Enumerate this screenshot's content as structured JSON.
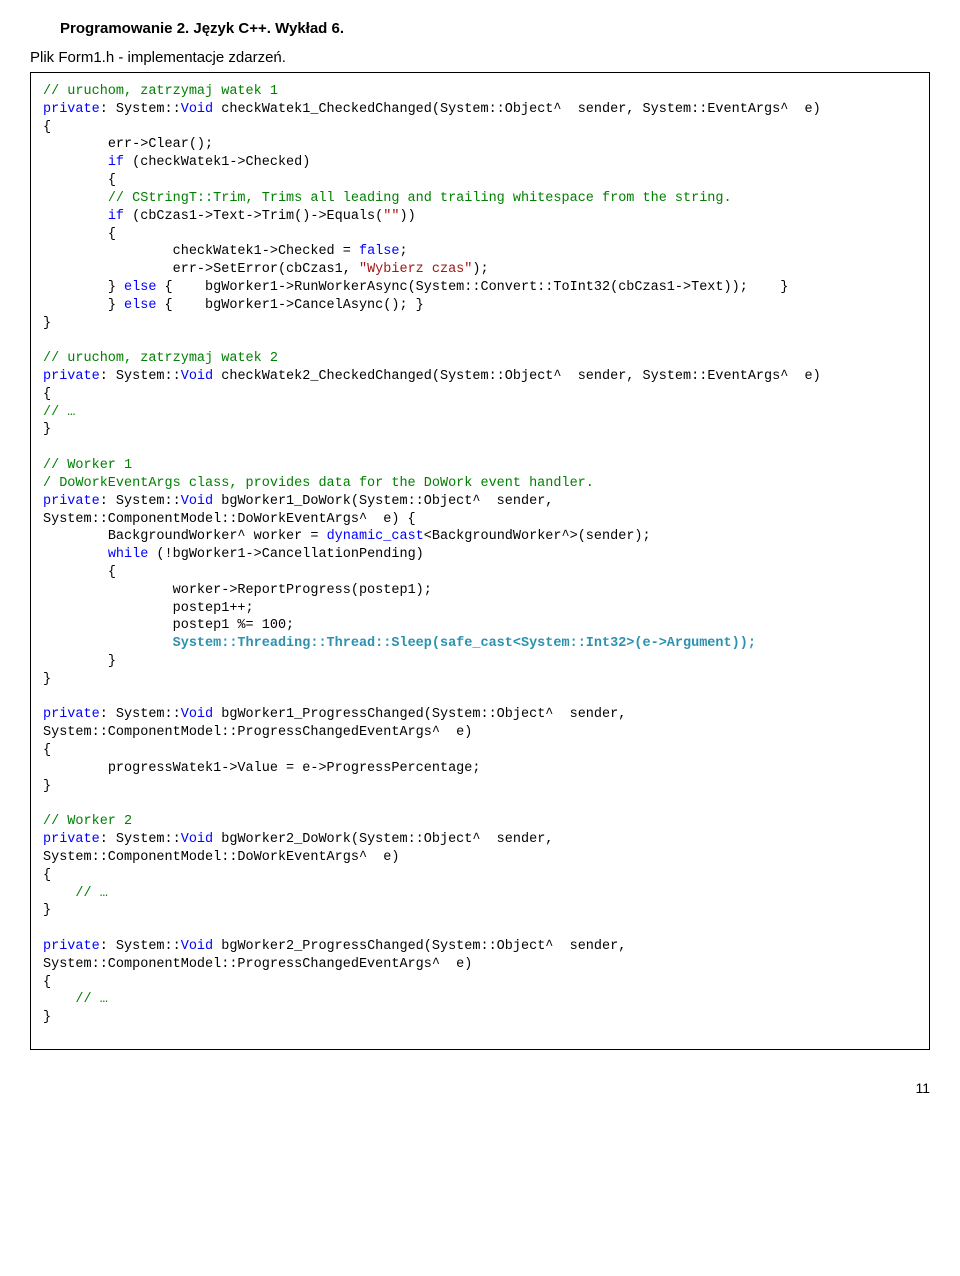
{
  "meta": {
    "title": "Programowanie 2. Język C++. Wykład 6.",
    "subtitle": "Plik Form1.h - implementacje zdarzeń.",
    "page_number": "11"
  },
  "code": {
    "l1": "// uruchom, zatrzymaj watek 1",
    "l2a": "private",
    "l2b": ": System::",
    "l2c": "Void",
    "l2d": " checkWatek1_CheckedChanged(System::Object^  sender, System::EventArgs^  e)",
    "l3": "{",
    "l4": "        err->Clear();",
    "l5a": "        ",
    "l5b": "if",
    "l5c": " (checkWatek1->Checked)",
    "l6": "        {",
    "l7": "        // CStringT::Trim, Trims all leading and trailing whitespace from the string.",
    "l8a": "        ",
    "l8b": "if",
    "l8c": " (cbCzas1->Text->Trim()->Equals(",
    "l8d": "\"\"",
    "l8e": "))",
    "l9": "        {",
    "l10a": "                checkWatek1->Checked = ",
    "l10b": "false",
    "l10c": ";",
    "l11a": "                err->SetError(cbCzas1, ",
    "l11b": "\"Wybierz czas\"",
    "l11c": ");",
    "l12a": "        } ",
    "l12b": "else",
    "l12c": " {    bgWorker1->RunWorkerAsync(System::Convert::ToInt32(cbCzas1->Text));    }",
    "l13a": "        } ",
    "l13b": "else",
    "l13c": " {    bgWorker1->CancelAsync(); }",
    "l14": "}",
    "l16": "// uruchom, zatrzymaj watek 2",
    "l17a": "private",
    "l17b": ": System::",
    "l17c": "Void",
    "l17d": " checkWatek2_CheckedChanged(System::Object^  sender, System::EventArgs^  e)",
    "l18": "{",
    "l19": "// …",
    "l20": "}",
    "l22": "// Worker 1",
    "l23": "/ DoWorkEventArgs class, provides data for the DoWork event handler.",
    "l24a": "private",
    "l24b": ": System::",
    "l24c": "Void",
    "l24d": " bgWorker1_DoWork(System::Object^  sender,",
    "l25": "System::ComponentModel::DoWorkEventArgs^  e) {",
    "l26a": "        BackgroundWorker^ worker = ",
    "l26b": "dynamic_cast",
    "l26c": "<BackgroundWorker^>(sender);",
    "l27a": "        ",
    "l27b": "while",
    "l27c": " (!bgWorker1->CancellationPending)",
    "l28": "        {",
    "l29": "                worker->ReportProgress(postep1);",
    "l30": "                postep1++;",
    "l31": "                postep1 %= 100;",
    "l32": "                System::Threading::Thread::Sleep(safe_cast<System::Int32>(e->Argument));",
    "l33": "        }",
    "l34": "}",
    "l36a": "private",
    "l36b": ": System::",
    "l36c": "Void",
    "l36d": " bgWorker1_ProgressChanged(System::Object^  sender,",
    "l37": "System::ComponentModel::ProgressChangedEventArgs^  e)",
    "l38": "{",
    "l39": "        progressWatek1->Value = e->ProgressPercentage;",
    "l40": "}",
    "l42": "// Worker 2",
    "l43a": "private",
    "l43b": ": System::",
    "l43c": "Void",
    "l43d": " bgWorker2_DoWork(System::Object^  sender,",
    "l44": "System::ComponentModel::DoWorkEventArgs^  e)",
    "l45": "{",
    "l46": "    // …",
    "l47": "}",
    "l49a": "private",
    "l49b": ": System::",
    "l49c": "Void",
    "l49d": " bgWorker2_ProgressChanged(System::Object^  sender,",
    "l50": "System::ComponentModel::ProgressChangedEventArgs^  e)",
    "l51": "{",
    "l52": "    // …",
    "l53": "}"
  }
}
